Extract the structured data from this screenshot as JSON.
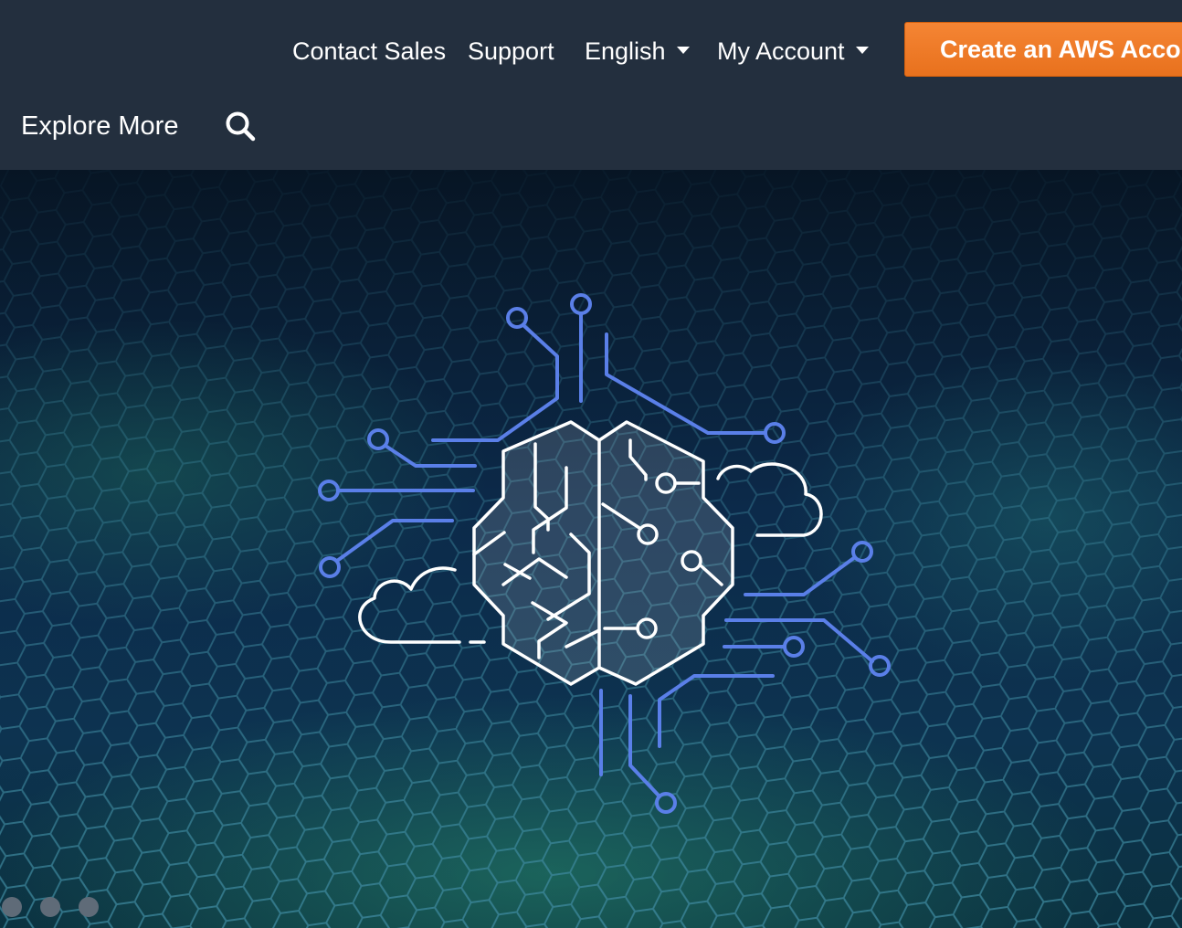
{
  "nav": {
    "contact_sales": "Contact Sales",
    "support": "Support",
    "language": "English",
    "my_account": "My Account",
    "create_account": "Create an AWS Account",
    "explore_more": "Explore More"
  },
  "icons": {
    "search": "search-icon",
    "language_caret": "chevron-down-icon",
    "account_caret": "chevron-down-icon",
    "hero_graphic": "ai-brain-circuit-icon"
  },
  "carousel": {
    "slide_count": 3
  },
  "colors": {
    "nav_background": "#232f3e",
    "cta_orange": "#ec7211",
    "circuit_blue": "#5a7fe8",
    "brain_outline": "#ffffff",
    "carousel_dot": "#5f6b78"
  }
}
